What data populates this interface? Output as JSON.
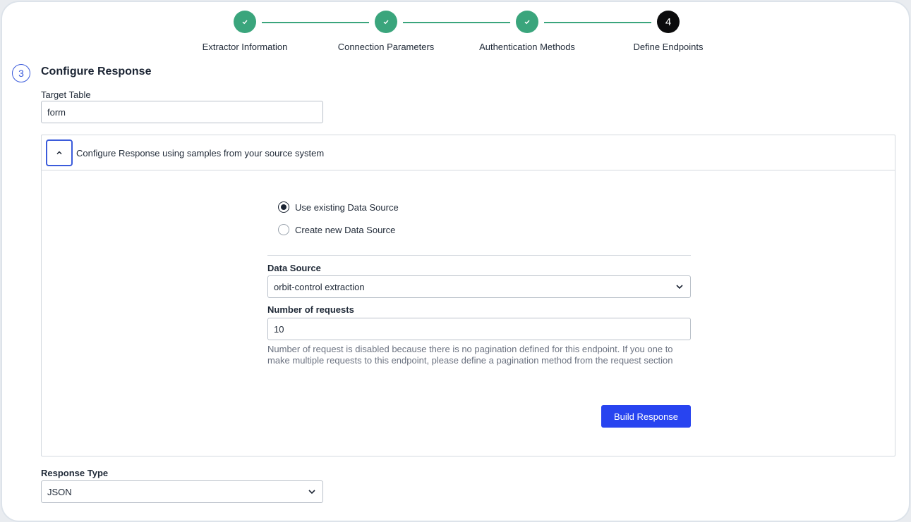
{
  "stepper": {
    "steps": [
      {
        "label": "Extractor Information",
        "state": "done"
      },
      {
        "label": "Connection Parameters",
        "state": "done"
      },
      {
        "label": "Authentication Methods",
        "state": "done"
      },
      {
        "label": "Define Endpoints",
        "state": "current",
        "number": "4"
      }
    ],
    "done_color": "#3aa57c",
    "current_color": "#0b0b0c"
  },
  "section": {
    "number": "3",
    "title": "Configure Response"
  },
  "target_table": {
    "label": "Target Table",
    "value": "form"
  },
  "sample_panel": {
    "title": "Configure Response using samples from your source system",
    "radio_options": [
      {
        "label": "Use existing Data Source",
        "checked": true
      },
      {
        "label": "Create new Data Source",
        "checked": false
      }
    ],
    "data_source": {
      "label": "Data Source",
      "value": "orbit-control extraction"
    },
    "num_requests": {
      "label": "Number of requests",
      "value": "10",
      "help": "Number of request is disabled because there is no pagination defined for this endpoint. If you one to make multiple requests to this endpoint, please define a pagination method from the request section"
    },
    "build_button": "Build Response"
  },
  "response_type": {
    "label": "Response Type",
    "value": "JSON"
  },
  "colors": {
    "accent": "#3b5bdb",
    "primary_button": "#2844f0"
  }
}
